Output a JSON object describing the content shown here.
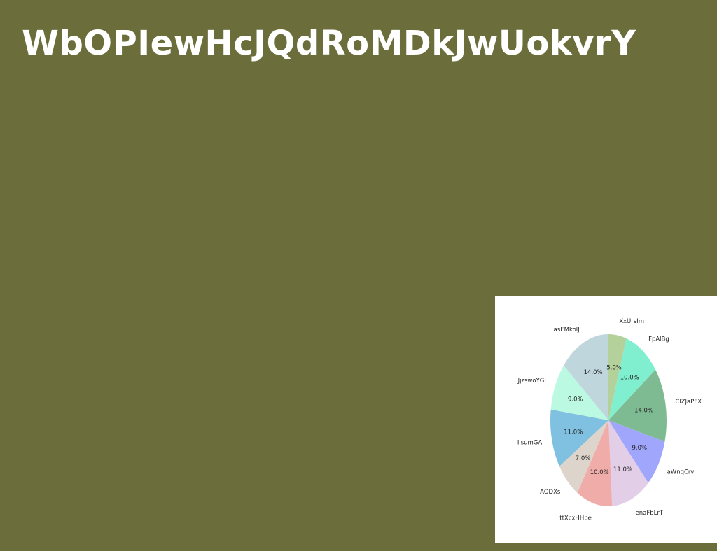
{
  "page": {
    "title": "WbOPIewHcJQdRoMDkJwUokvrY",
    "background": "#6b6e3b"
  },
  "chart_data": {
    "type": "pie",
    "title": "",
    "start_angle_deg": 90,
    "direction": "clockwise",
    "slices": [
      {
        "label": "XxUrsIm",
        "value": 5.0,
        "pct_label": "5.0%",
        "color": "#b5d19b"
      },
      {
        "label": "FpAlBg",
        "value": 10.0,
        "pct_label": "10.0%",
        "color": "#7fefcf"
      },
      {
        "label": "ClZJaPFX",
        "value": 14.0,
        "pct_label": "14.0%",
        "color": "#7fbb92"
      },
      {
        "label": "aWnqCrv",
        "value": 9.0,
        "pct_label": "9.0%",
        "color": "#a0a6fb"
      },
      {
        "label": "enaFbLrT",
        "value": 11.0,
        "pct_label": "11.0%",
        "color": "#e2cee6"
      },
      {
        "label": "ttXcxHHpe",
        "value": 10.0,
        "pct_label": "10.0%",
        "color": "#f0aca8"
      },
      {
        "label": "AODXs",
        "value": 7.0,
        "pct_label": "7.0%",
        "color": "#ddd4cb"
      },
      {
        "label": "IlsumGA",
        "value": 11.0,
        "pct_label": "11.0%",
        "color": "#80c0e0"
      },
      {
        "label": "JjzswoYGI",
        "value": 9.0,
        "pct_label": "9.0%",
        "color": "#bcf9e2"
      },
      {
        "label": "asEMkolJ",
        "value": 14.0,
        "pct_label": "14.0%",
        "color": "#bfd6dc"
      }
    ]
  }
}
